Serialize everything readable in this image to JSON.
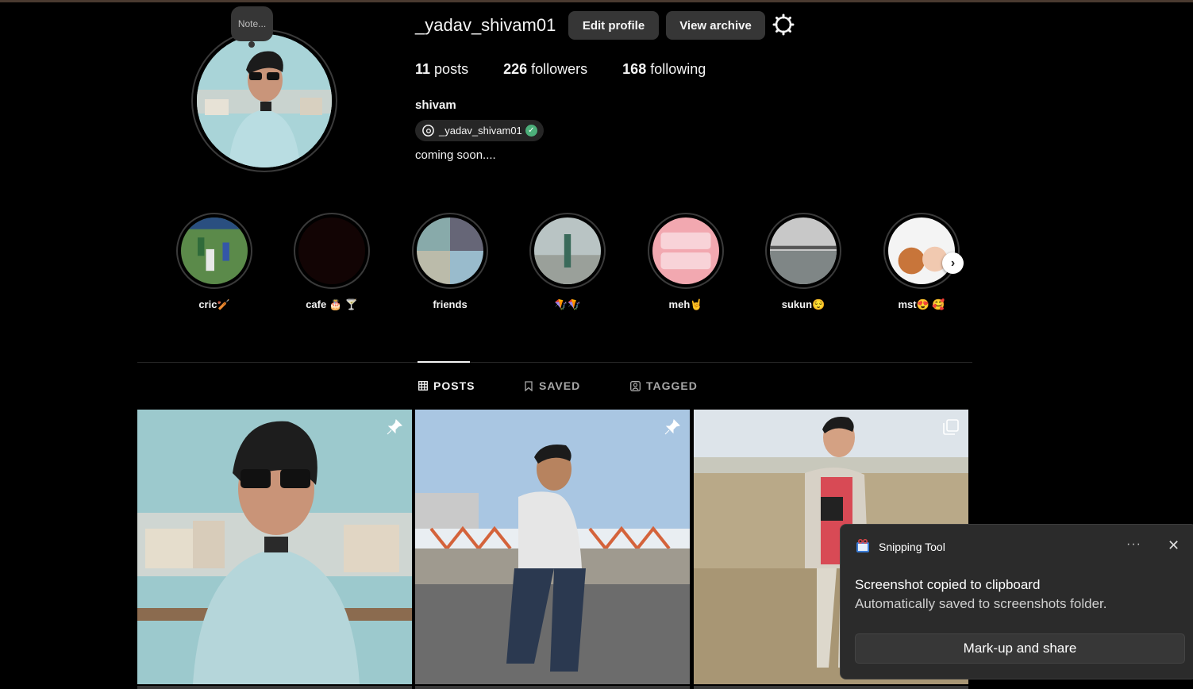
{
  "profile": {
    "note_label": "Note...",
    "username": "_yadav_shivam01",
    "edit_profile_label": "Edit profile",
    "view_archive_label": "View archive",
    "posts_count": "11",
    "posts_label": "posts",
    "followers_count": "226",
    "followers_label": "followers",
    "following_count": "168",
    "following_label": "following",
    "full_name": "shivam",
    "threads_handle": "_yadav_shivam01",
    "bio": "coming soon...."
  },
  "highlights": [
    {
      "label": "cric🏏"
    },
    {
      "label": "cafe 🎂 🍸"
    },
    {
      "label": "friends"
    },
    {
      "label": "🪁🪁"
    },
    {
      "label": "meh🤘"
    },
    {
      "label": "sukun😌"
    },
    {
      "label": "mst😍 🥰"
    }
  ],
  "tabs": [
    {
      "label": "POSTS",
      "icon": "grid-icon",
      "active": true
    },
    {
      "label": "SAVED",
      "icon": "bookmark-icon",
      "active": false
    },
    {
      "label": "TAGGED",
      "icon": "tag-person-icon",
      "active": false
    }
  ],
  "posts": [
    {
      "badge": "pin-icon"
    },
    {
      "badge": "pin-icon"
    },
    {
      "badge": "carousel-icon"
    }
  ],
  "toast": {
    "app_name": "Snipping Tool",
    "title": "Screenshot copied to clipboard",
    "subtitle": "Automatically saved to screenshots folder.",
    "action_label": "Mark-up and share",
    "more_label": "···",
    "close_label": "✕"
  },
  "colors": {
    "background": "#000000",
    "button": "#363636",
    "toast_bg": "#2b2b2b",
    "verified": "#4caf7a"
  }
}
